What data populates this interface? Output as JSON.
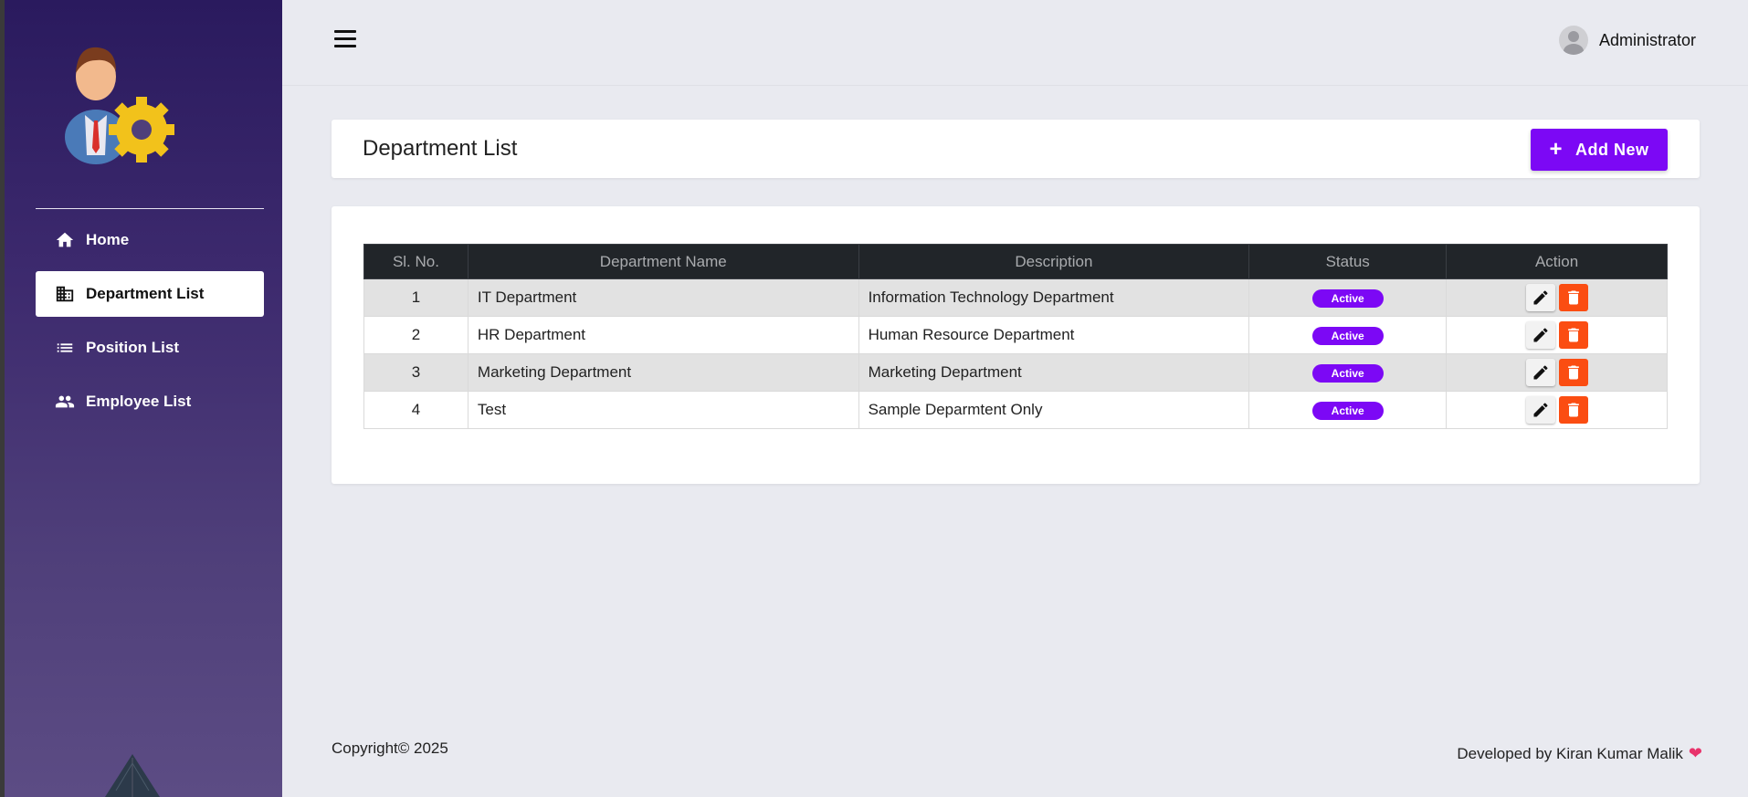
{
  "header": {
    "user_name": "Administrator"
  },
  "sidebar": {
    "items": [
      {
        "label": "Home",
        "icon": "home-icon",
        "active": false
      },
      {
        "label": "Department List",
        "icon": "building-icon",
        "active": true
      },
      {
        "label": "Position List",
        "icon": "list-icon",
        "active": false
      },
      {
        "label": "Employee List",
        "icon": "people-icon",
        "active": false
      }
    ]
  },
  "page": {
    "title": "Department List",
    "add_label": "Add New"
  },
  "table": {
    "headers": [
      "Sl. No.",
      "Department Name",
      "Description",
      "Status",
      "Action"
    ],
    "rows": [
      {
        "no": "1",
        "name": "IT Department",
        "description": "Information Technology Department",
        "status": "Active"
      },
      {
        "no": "2",
        "name": "HR Department",
        "description": "Human Resource Department",
        "status": "Active"
      },
      {
        "no": "3",
        "name": "Marketing Department",
        "description": "Marketing Department",
        "status": "Active"
      },
      {
        "no": "4",
        "name": "Test",
        "description": "Sample Deparmtent Only",
        "status": "Active"
      }
    ]
  },
  "footer": {
    "copyright": "Copyright© 2025",
    "developer": "Developed by Kiran Kumar Malik"
  },
  "colors": {
    "accent": "#7c08f5",
    "danger": "#fb4d12",
    "table_header": "#212529"
  }
}
